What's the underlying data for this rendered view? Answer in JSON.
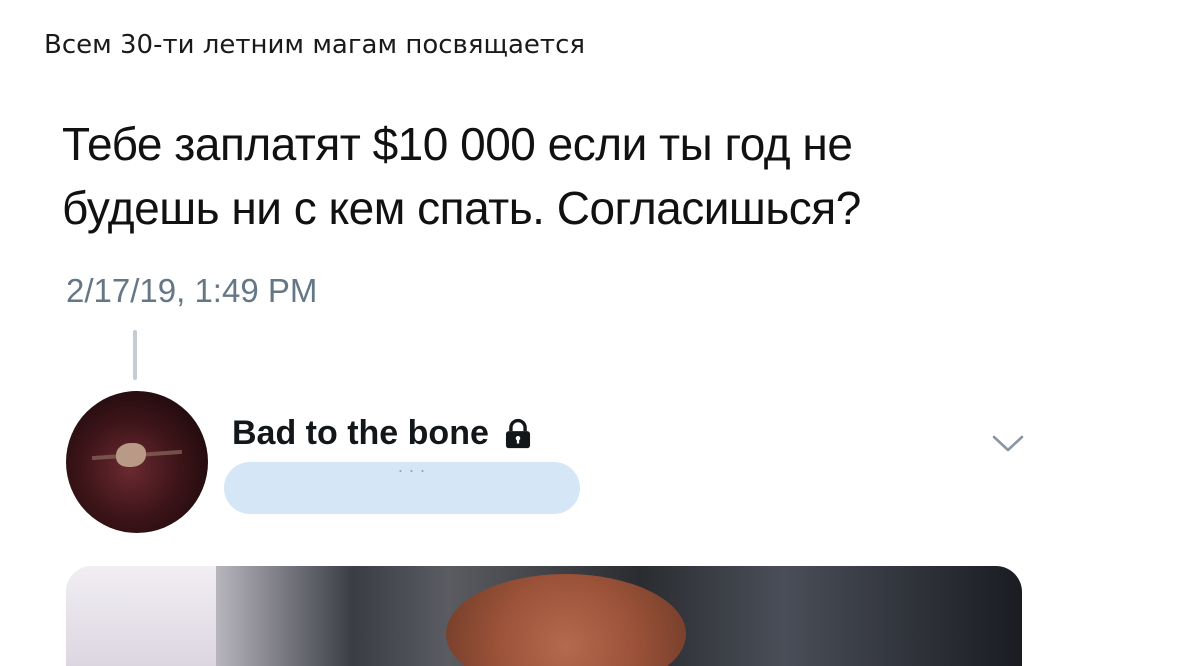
{
  "post": {
    "caption": "Всем 30-ти летним магам посвящается"
  },
  "tweet": {
    "text_line1": "Тебе заплатят $10 000 если ты год не",
    "text_line2": "будешь ни с кем спать. Согласишься?",
    "timestamp": "2/17/19, 1:49 PM"
  },
  "reply": {
    "author_name": "Bad to the bone",
    "handle_dots": "...",
    "icons": {
      "lock": "lock-icon",
      "menu": "chevron-down-icon"
    }
  },
  "colors": {
    "text": "#111111",
    "muted": "#657786",
    "thread_line": "#c4ccd3",
    "redaction": "#d5e7f6"
  }
}
